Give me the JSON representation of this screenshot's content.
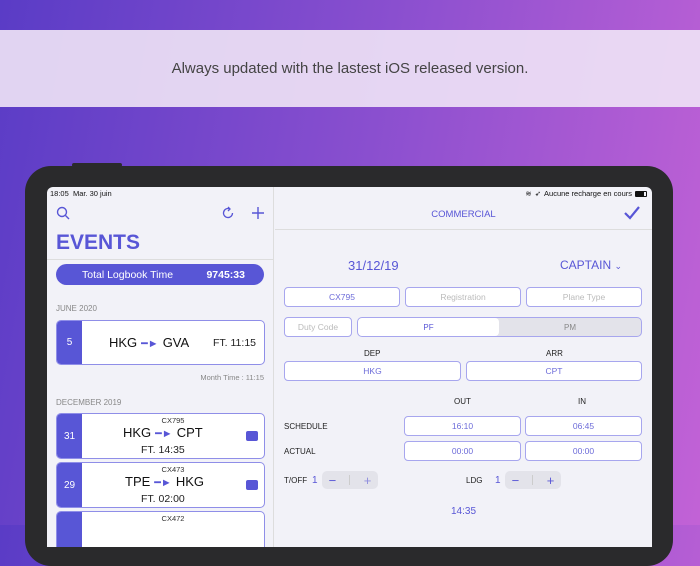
{
  "banner": "Always updated with the lastest iOS released version.",
  "status": {
    "time": "18:05",
    "date": "Mar. 30 juin",
    "right": "Aucune recharge en cours"
  },
  "left": {
    "title": "EVENTS",
    "total_label": "Total Logbook Time",
    "total_value": "9745:33",
    "sections": [
      {
        "label": "JUNE 2020",
        "month_time": "Month Time : 11:15"
      },
      {
        "label": "DECEMBER 2019"
      }
    ],
    "events": [
      {
        "day": "5",
        "from": "HKG",
        "to": "GVA",
        "ft": "FT. 11:15"
      },
      {
        "day": "31",
        "flight": "CX795",
        "from": "HKG",
        "to": "CPT",
        "ft": "FT. 14:35"
      },
      {
        "day": "29",
        "flight": "CX473",
        "from": "TPE",
        "to": "HKG",
        "ft": "FT. 02:00"
      },
      {
        "flight": "CX472"
      }
    ]
  },
  "right": {
    "header": "COMMERCIAL",
    "date": "31/12/19",
    "role": "CAPTAIN",
    "flight": "CX795",
    "registration_placeholder": "Registration",
    "plane_type_placeholder": "Plane Type",
    "duty_code_placeholder": "Duty Code",
    "pf": "PF",
    "pm": "PM",
    "dep_label": "DEP",
    "arr_label": "ARR",
    "dep": "HKG",
    "arr": "CPT",
    "out_label": "OUT",
    "in_label": "IN",
    "schedule_label": "SCHEDULE",
    "actual_label": "ACTUAL",
    "schedule_out": "16:10",
    "schedule_in": "06:45",
    "actual_out": "00:00",
    "actual_in": "00:00",
    "toff_label": "T/OFF",
    "toff": "1",
    "ldg_label": "LDG",
    "ldg": "1",
    "total": "14:35"
  },
  "colors": {
    "accent": "#5856d6"
  }
}
